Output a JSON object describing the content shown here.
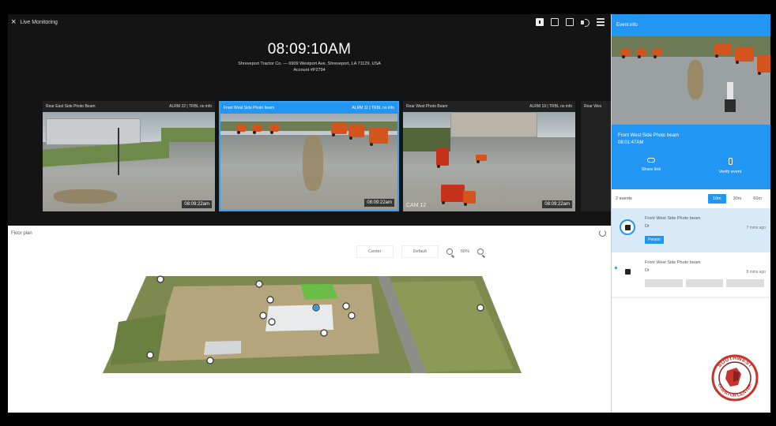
{
  "live": {
    "close_icon": "close-icon",
    "title": "Live Monitoring",
    "clock": "08:09:10AM",
    "address": "Shreveport Tractor Co. — 6909 Westport Ave, Shreveport, LA 71129, USA",
    "account": "Account #P2794"
  },
  "toolbar": [
    "layout-1-icon",
    "layout-2-icon",
    "layout-3-icon",
    "volume-icon",
    "menu-icon"
  ],
  "cameras": [
    {
      "name": "Rear East Side Photo Beam",
      "status": "ALRM 22 | TRBL no info",
      "time": "08:09:22am",
      "label": ""
    },
    {
      "name": "Front West Side Photo beam",
      "status": "ALRM 11 | TRBL no info",
      "time": "08:09:22am",
      "label": ""
    },
    {
      "name": "Rear West Photo Beam",
      "status": "ALRM 19 | TRBL no info",
      "time": "08:09:22am",
      "label": "CAM 12"
    },
    {
      "name": "Rear Wes",
      "status": "",
      "time": "",
      "label": ""
    }
  ],
  "floor": {
    "title": "Floor plan",
    "center": "Center",
    "default": "Default",
    "zoom": "50%"
  },
  "event": {
    "header": "Event info",
    "camera": "Front West Side Photo beam",
    "time": "08:01:47AM",
    "share": "Share link",
    "verify": "Verify event",
    "count": "2 events",
    "filters": [
      "10m",
      "30m",
      "60m"
    ],
    "items": [
      {
        "title": "Front West Side Photo beam",
        "desc": "Dr",
        "ago": "7 mins ago",
        "tag": "Person"
      },
      {
        "title": "Front West Side Photo beam",
        "desc": "Dr",
        "ago": "8 mins ago",
        "tag": ""
      }
    ]
  },
  "logo": {
    "text_top": "SOUTHWEST",
    "text_bottom": "DISPATCH CENTER"
  },
  "colors": {
    "accent": "#2196f3",
    "dark": "#141414"
  }
}
